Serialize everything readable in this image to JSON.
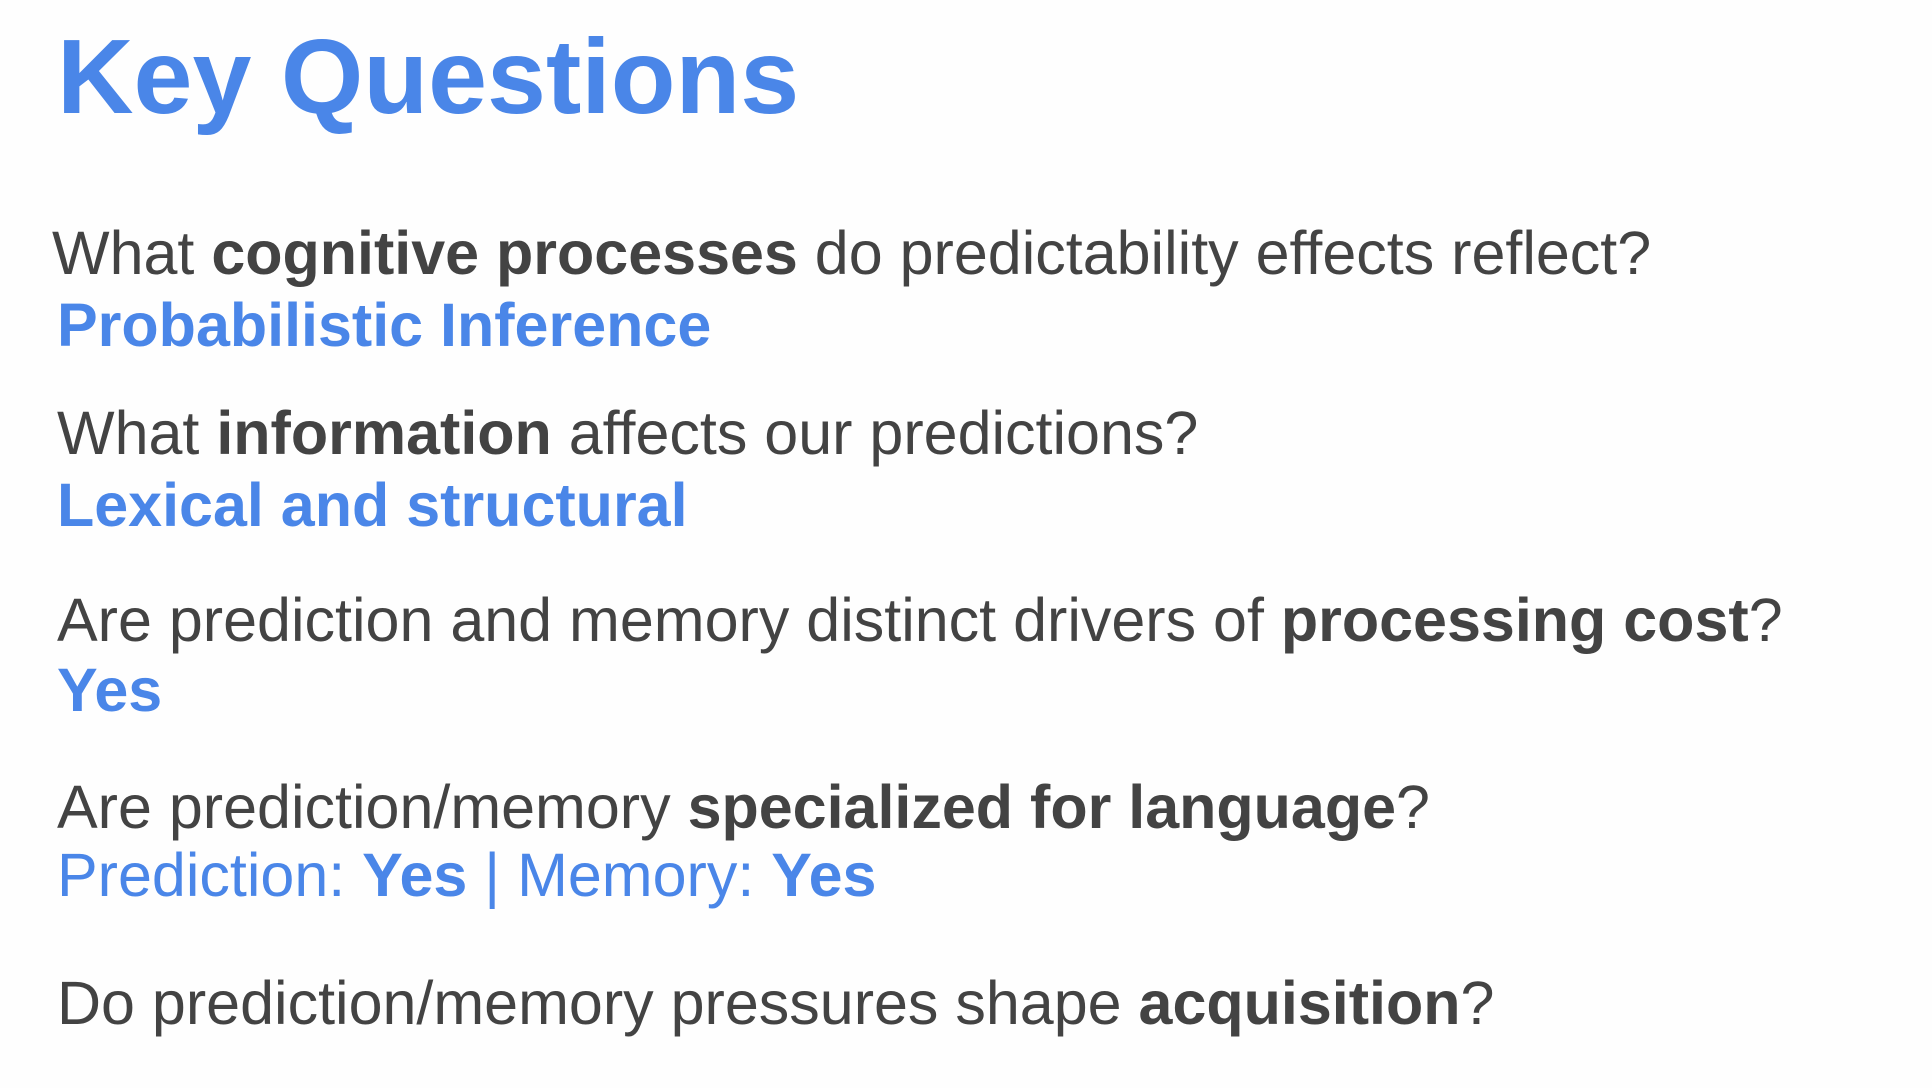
{
  "slide": {
    "title": "Key Questions",
    "colors": {
      "accent": "#4a86e8",
      "text": "#434343",
      "background": "#fefefe"
    },
    "q1": {
      "pre": "What ",
      "bold": "cognitive processes",
      "post": " do predictability effects reflect?",
      "answer": "Probabilistic Inference"
    },
    "q2": {
      "pre": "What ",
      "bold": "information",
      "post": " affects our predictions?",
      "answer": "Lexical and structural"
    },
    "q3": {
      "pre": "Are prediction and memory distinct drivers of ",
      "bold": "processing cost",
      "post": "?",
      "answer": "Yes"
    },
    "q4": {
      "pre": "Are prediction/memory ",
      "bold": "specialized for language",
      "post": "?",
      "answer_parts": {
        "label1": "Prediction: ",
        "value1": "Yes",
        "sep": " | Memory: ",
        "value2": "Yes"
      }
    },
    "q5": {
      "pre": "Do prediction/memory pressures shape ",
      "bold": "acquisition",
      "post": "?"
    }
  }
}
